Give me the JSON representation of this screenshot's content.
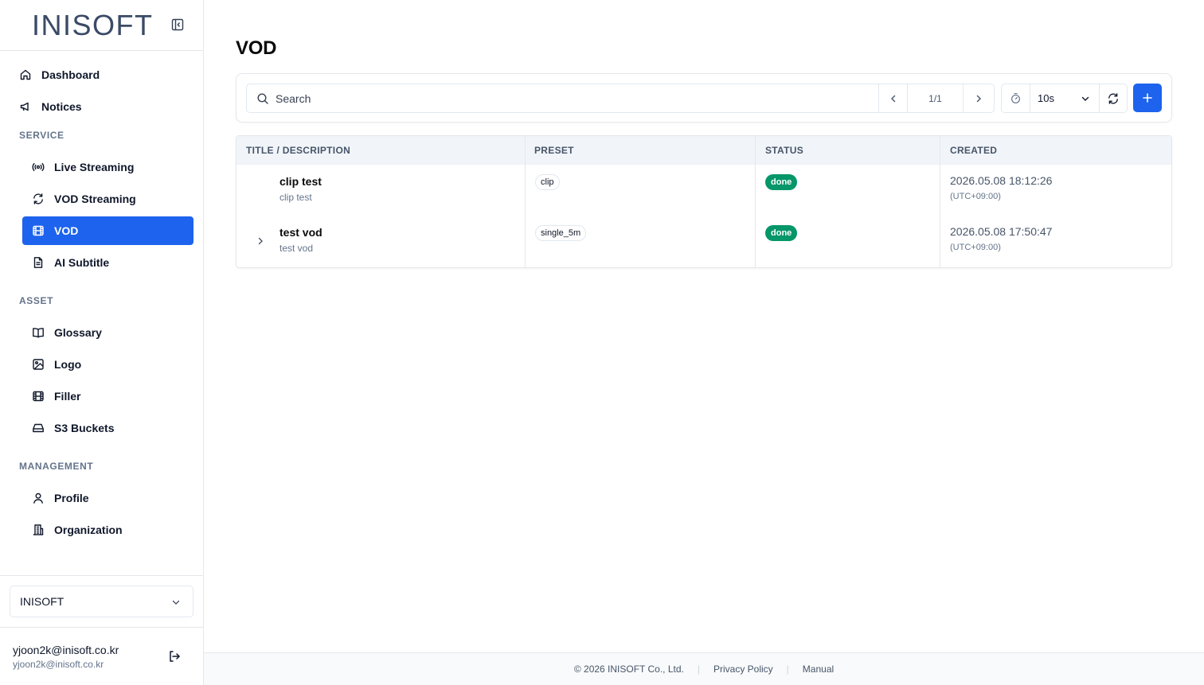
{
  "brand": {
    "logo_text": "INISOFT"
  },
  "nav": {
    "top": [
      {
        "label": "Dashboard",
        "icon": "home-icon"
      },
      {
        "label": "Notices",
        "icon": "megaphone-icon"
      }
    ],
    "sections": [
      {
        "label": "SERVICE",
        "items": [
          {
            "label": "Live Streaming",
            "icon": "broadcast-icon"
          },
          {
            "label": "VOD Streaming",
            "icon": "refresh-icon"
          },
          {
            "label": "VOD",
            "icon": "film-icon",
            "active": true
          },
          {
            "label": "AI Subtitle",
            "icon": "document-icon"
          }
        ]
      },
      {
        "label": "ASSET",
        "items": [
          {
            "label": "Glossary",
            "icon": "book-icon"
          },
          {
            "label": "Logo",
            "icon": "image-icon"
          },
          {
            "label": "Filler",
            "icon": "film-icon"
          },
          {
            "label": "S3 Buckets",
            "icon": "drive-icon"
          }
        ]
      },
      {
        "label": "MANAGEMENT",
        "items": [
          {
            "label": "Profile",
            "icon": "user-icon"
          },
          {
            "label": "Organization",
            "icon": "building-icon"
          }
        ]
      }
    ]
  },
  "org_select": {
    "value": "INISOFT"
  },
  "user": {
    "name": "yjoon2k@inisoft.co.kr",
    "email": "yjoon2k@inisoft.co.kr"
  },
  "page": {
    "title": "VOD"
  },
  "toolbar": {
    "search_placeholder": "Search",
    "pagination": "1/1",
    "refresh_interval": "10s"
  },
  "table": {
    "columns": [
      "TITLE / DESCRIPTION",
      "PRESET",
      "STATUS",
      "CREATED"
    ],
    "rows": [
      {
        "title": "clip test",
        "description": "clip test",
        "preset": "clip",
        "status": "done",
        "created": "2026.05.08 18:12:26",
        "timezone": "(UTC+09:00)",
        "expandable": false
      },
      {
        "title": "test vod",
        "description": "test vod",
        "preset": "single_5m",
        "status": "done",
        "created": "2026.05.08 17:50:47",
        "timezone": "(UTC+09:00)",
        "expandable": true
      }
    ]
  },
  "footer": {
    "copyright": "© 2026 INISOFT Co., Ltd.",
    "privacy": "Privacy Policy",
    "manual": "Manual"
  },
  "colors": {
    "accent": "#1d63ed",
    "status_done": "#059669"
  }
}
